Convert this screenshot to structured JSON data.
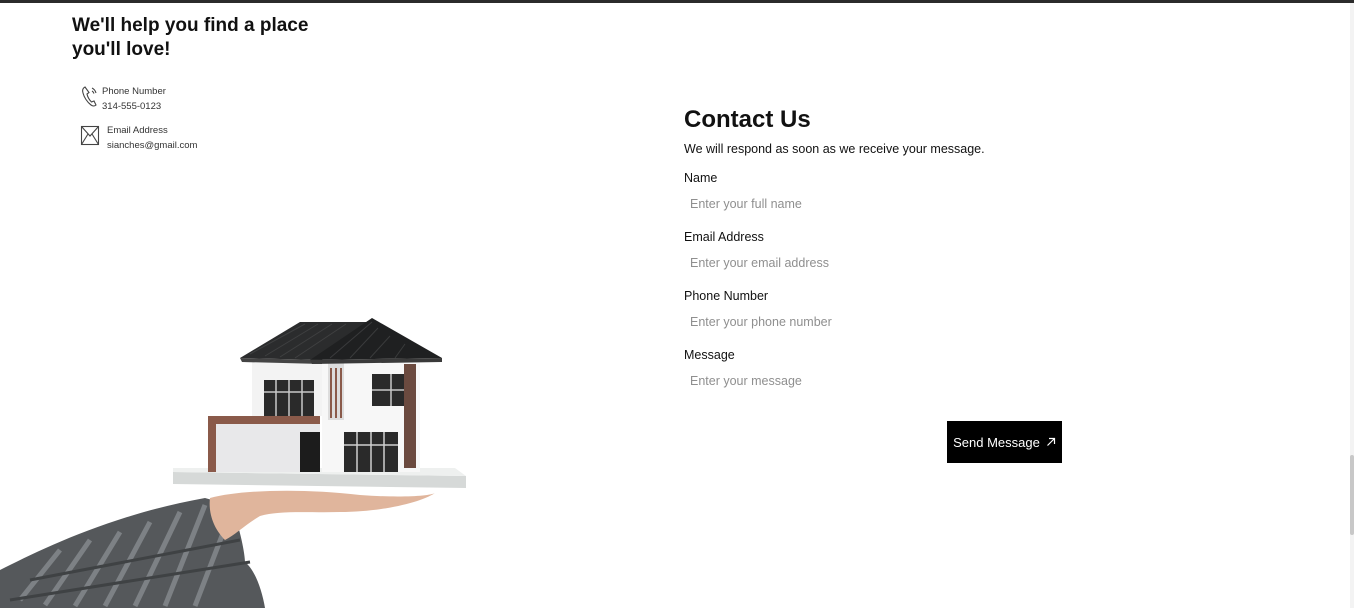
{
  "tagline": "We'll help you find a place you'll love!",
  "contact_info": {
    "phone_label": "Phone Number",
    "phone_value": "314-555-0123",
    "email_label": "Email Address",
    "email_value": "sianches@gmail.com",
    "phone_icon": "phone-icon",
    "email_icon": "envelope-icon"
  },
  "hero_image": "hand-holding-house-model",
  "contact_form": {
    "title": "Contact Us",
    "subtitle": "We will respond as soon as we receive your message.",
    "fields": [
      {
        "label": "Name",
        "placeholder": "Enter your full name",
        "value": ""
      },
      {
        "label": "Email Address",
        "placeholder": "Enter your email address",
        "value": ""
      },
      {
        "label": "Phone Number",
        "placeholder": "Enter your phone number",
        "value": ""
      },
      {
        "label": "Message",
        "placeholder": "Enter your message",
        "value": ""
      }
    ],
    "submit_label": "Send Message",
    "submit_icon": "arrow-up-right-icon"
  },
  "colors": {
    "text": "#111111",
    "button_bg": "#000000",
    "button_text": "#ffffff",
    "placeholder": "#8f8f8f"
  }
}
